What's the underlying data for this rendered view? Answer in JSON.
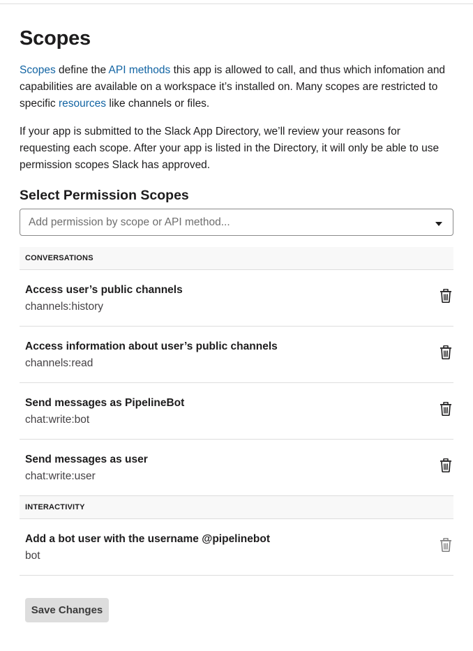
{
  "header": {
    "title": "Scopes"
  },
  "intro": {
    "link_scopes": "Scopes",
    "text1": " define the ",
    "link_api_methods": "API methods",
    "text2": " this app is allowed to call, and thus which infomation and capabilities are available on a workspace it’s installed on. Many scopes are restricted to specific ",
    "link_resources": "resources",
    "text3": " like channels or files."
  },
  "review_note": "If your app is submitted to the Slack App Directory, we’ll review your reasons for requesting each scope. After your app is listed in the Directory, it will only be able to use permission scopes Slack has approved.",
  "select_section": {
    "title": "Select Permission Scopes",
    "placeholder": "Add permission by scope or API method...",
    "value": ""
  },
  "groups": [
    {
      "label": "CONVERSATIONS",
      "scopes": [
        {
          "title": "Access user’s public channels",
          "scope": "channels:history"
        },
        {
          "title": "Access information about user’s public channels",
          "scope": "channels:read"
        },
        {
          "title": "Send messages as PipelineBot",
          "scope": "chat:write:bot"
        },
        {
          "title": "Send messages as user",
          "scope": "chat:write:user"
        }
      ]
    },
    {
      "label": "INTERACTIVITY",
      "scopes": [
        {
          "title": "Add a bot user with the username @pipelinebot",
          "scope": "bot"
        }
      ]
    }
  ],
  "icons": {
    "remove": "trash-icon",
    "dropdown": "caret-down-icon"
  },
  "colors": {
    "link": "#1264a3",
    "text": "#1d1c1d",
    "muted": "#454245",
    "button_bg": "#dddddd"
  },
  "actions": {
    "save_label": "Save Changes"
  }
}
